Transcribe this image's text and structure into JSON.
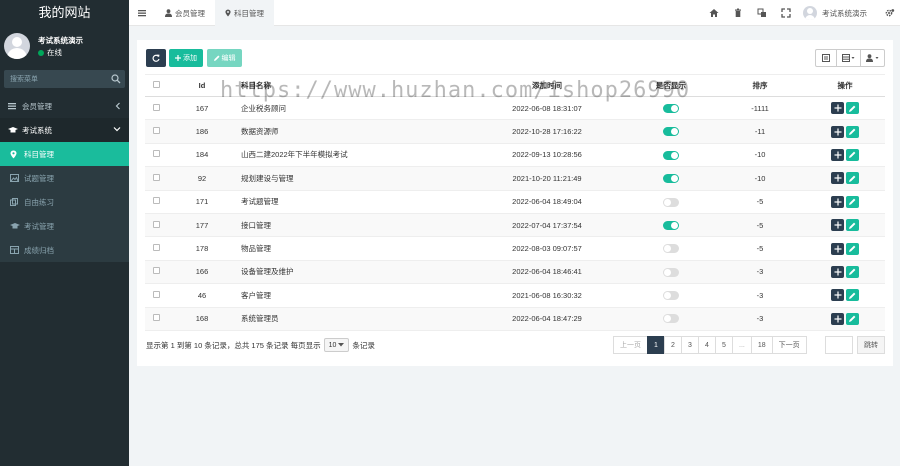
{
  "sidebar": {
    "site_title": "我的网站",
    "user_name": "考试系统演示",
    "user_status": "在线",
    "search_placeholder": "搜索菜单",
    "menu": [
      {
        "label": "会员管理",
        "icon": "list-icon"
      },
      {
        "label": "考试系统",
        "icon": "graduation-cap-icon"
      },
      {
        "label": "科目管理",
        "icon": "map-marker-icon"
      },
      {
        "label": "试题管理",
        "icon": "image-icon"
      },
      {
        "label": "自由练习",
        "icon": "copy-icon"
      },
      {
        "label": "考试管理",
        "icon": "graduation-cap-icon"
      },
      {
        "label": "成绩归档",
        "icon": "table-icon"
      }
    ]
  },
  "topbar": {
    "tabs": [
      {
        "label": "会员管理",
        "icon": "user-icon"
      },
      {
        "label": "科目管理",
        "icon": "map-marker-icon"
      }
    ],
    "user_name": "考试系统演示",
    "icons": [
      "home-icon",
      "trash-icon",
      "language-icon",
      "fullscreen-icon",
      "gears-icon"
    ]
  },
  "toolbar": {
    "add_label": "添加",
    "edit_label": "编辑"
  },
  "table": {
    "headers": {
      "id": "Id",
      "name": "科目名称",
      "time": "添加时间",
      "show": "是否显示",
      "sort": "排序",
      "ops": "操作"
    },
    "rows": [
      {
        "id": "167",
        "name": "企业税务顾问",
        "time": "2022-06-08 18:31:07",
        "show": true,
        "sort": "-1111"
      },
      {
        "id": "186",
        "name": "数据资源师",
        "time": "2022-10-28 17:16:22",
        "show": true,
        "sort": "-11"
      },
      {
        "id": "184",
        "name": "山西二建2022年下半年模拟考试",
        "time": "2022-09-13 10:28:56",
        "show": true,
        "sort": "-10"
      },
      {
        "id": "92",
        "name": "规划建设与管理",
        "time": "2021-10-20 11:21:49",
        "show": true,
        "sort": "-10"
      },
      {
        "id": "171",
        "name": "考试题管理",
        "time": "2022-06-04 18:49:04",
        "show": false,
        "sort": "-5"
      },
      {
        "id": "177",
        "name": "接口管理",
        "time": "2022-07-04 17:37:54",
        "show": true,
        "sort": "-5"
      },
      {
        "id": "178",
        "name": "物品管理",
        "time": "2022-08-03 09:07:57",
        "show": false,
        "sort": "-5"
      },
      {
        "id": "166",
        "name": "设备管理及维护",
        "time": "2022-06-04 18:46:41",
        "show": false,
        "sort": "-3"
      },
      {
        "id": "46",
        "name": "客户管理",
        "time": "2021-06-08 16:30:32",
        "show": false,
        "sort": "-3"
      },
      {
        "id": "168",
        "name": "系统管理员",
        "time": "2022-06-04 18:47:29",
        "show": false,
        "sort": "-3"
      }
    ]
  },
  "pager": {
    "info_prefix": "显示第 1 到第 10 条记录，总共 175 条记录 每页显示",
    "page_size": "10",
    "info_suffix": "条记录",
    "prev": "上一页",
    "pages": [
      "1",
      "2",
      "3",
      "4",
      "5",
      "...",
      "18"
    ],
    "next": "下一页",
    "jump": "跳转"
  },
  "watermark": "https://www.huzhan.com/ishop26990",
  "colors": {
    "sidebar_bg": "#222d32",
    "accent": "#18bc9c",
    "dark_button": "#2c3e50"
  }
}
